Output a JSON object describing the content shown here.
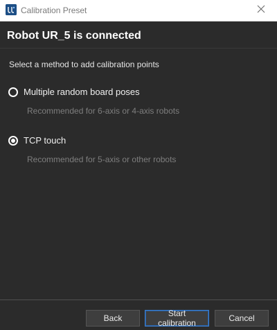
{
  "window": {
    "title": "Calibration Preset",
    "icon": "app-logo-icon",
    "close_icon": "close-icon"
  },
  "header": {
    "title": "Robot UR_5 is connected"
  },
  "main": {
    "instruction": "Select a method to add calibration points",
    "options": [
      {
        "label": "Multiple random board poses",
        "description": "Recommended for 6-axis or 4-axis robots",
        "selected": false
      },
      {
        "label": "TCP touch",
        "description": "Recommended for 5-axis or other robots",
        "selected": true
      }
    ]
  },
  "footer": {
    "back_label": "Back",
    "start_label": "Start calibration",
    "cancel_label": "Cancel"
  },
  "colors": {
    "background": "#2b2b2b",
    "titlebar": "#ffffff",
    "primary_border": "#3d7fd0"
  }
}
